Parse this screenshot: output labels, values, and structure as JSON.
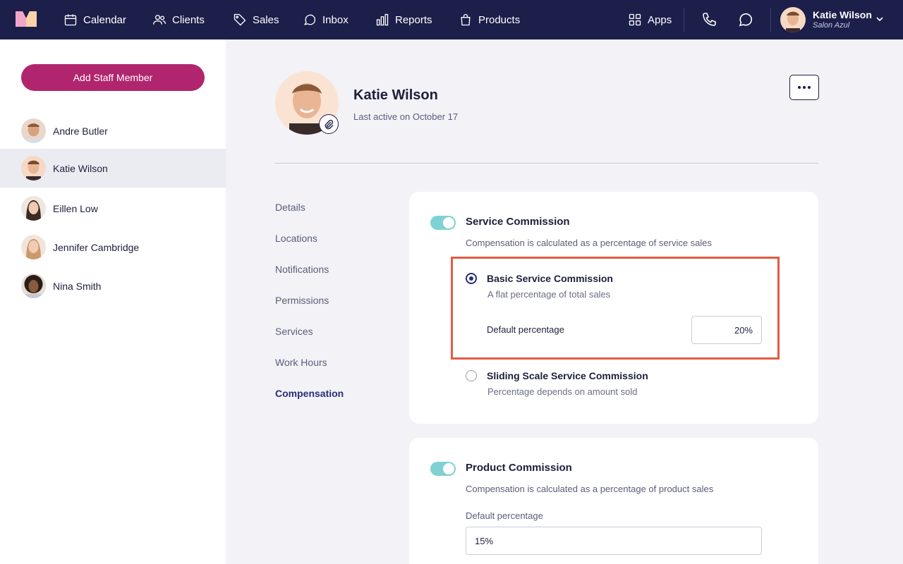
{
  "nav": {
    "items": [
      {
        "label": "Calendar",
        "icon": "calendar-icon"
      },
      {
        "label": "Clients",
        "icon": "users-icon"
      },
      {
        "label": "Sales",
        "icon": "tag-icon"
      },
      {
        "label": "Inbox",
        "icon": "inbox-icon"
      },
      {
        "label": "Reports",
        "icon": "bar-chart-icon"
      },
      {
        "label": "Products",
        "icon": "shopping-bag-icon"
      }
    ],
    "apps_label": "Apps",
    "user": {
      "name": "Katie Wilson",
      "salon": "Salon Azul"
    }
  },
  "sidebar": {
    "add_button": "Add Staff Member",
    "staff": [
      {
        "name": "Andre Butler"
      },
      {
        "name": "Katie Wilson",
        "active": true
      },
      {
        "name": "Eillen Low"
      },
      {
        "name": "Jennifer Cambridge"
      },
      {
        "name": "Nina Smith"
      }
    ]
  },
  "profile": {
    "name": "Katie Wilson",
    "last_active": "Last active on October 17"
  },
  "subnav": {
    "items": [
      "Details",
      "Locations",
      "Notifications",
      "Permissions",
      "Services",
      "Work Hours",
      "Compensation"
    ],
    "active": "Compensation"
  },
  "service_commission": {
    "title": "Service Commission",
    "description": "Compensation is calculated as a percentage of service sales",
    "enabled": true,
    "options": [
      {
        "title": "Basic Service Commission",
        "description": "A flat percentage of total sales",
        "selected": true
      },
      {
        "title": "Sliding Scale Service Commission",
        "description": "Percentage depends on amount sold",
        "selected": false
      }
    ],
    "default_label": "Default percentage",
    "default_value": "20%"
  },
  "product_commission": {
    "title": "Product Commission",
    "description": "Compensation is calculated as a percentage of product sales",
    "enabled": true,
    "default_label": "Default percentage",
    "default_value": "15%"
  },
  "colors": {
    "nav_bg": "#1c1f4a",
    "accent_pink": "#b1256e",
    "toggle_on": "#7fd1d4",
    "highlight": "#e45a45"
  }
}
